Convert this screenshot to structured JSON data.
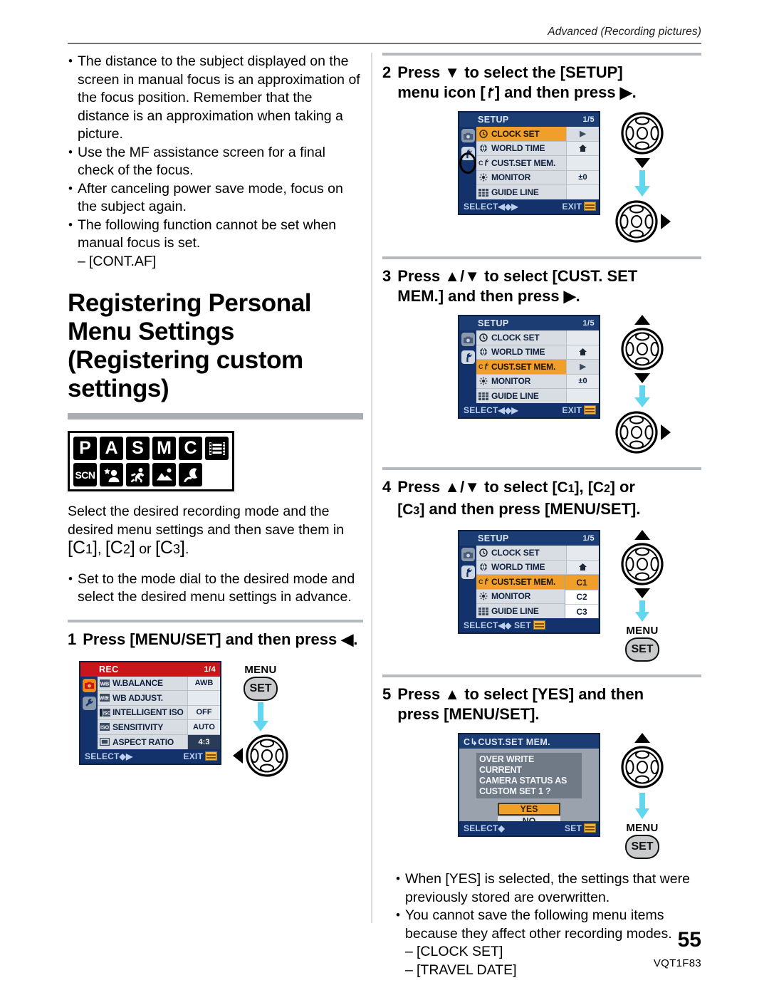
{
  "header": {
    "running_head": "Advanced (Recording pictures)"
  },
  "footer": {
    "page_number": "55",
    "doc_code": "VQT1F83"
  },
  "colors": {
    "accent_orange": "#f0a02a",
    "lcd_blue": "#13326b",
    "rec_red": "#c8161c",
    "arrow_cyan": "#63d6ef",
    "rule_gray": "#a9acb1"
  },
  "left_column": {
    "notes": [
      "The distance to the subject displayed on the screen in manual focus is an approximation of the focus position. Remember that the distance is an approximation when taking a picture.",
      "Use the MF assistance screen for a final check of the focus.",
      "After canceling power save mode, focus on the subject again.",
      "The following function cannot be set when manual focus is set."
    ],
    "note_sub_item": "[CONT.AF]",
    "section_title": "Registering Personal Menu Settings (Registering custom settings)",
    "mode_icons_row1": [
      "P",
      "A",
      "S",
      "M",
      "C",
      "movie-icon"
    ],
    "mode_icons_row2": [
      "SCN",
      "portrait-icon",
      "sports-icon",
      "scenery-icon",
      "night-portrait-icon"
    ],
    "intro_part1": "Select the desired recording mode and the desired menu settings and then save them in ",
    "intro_c1": "[C1]",
    "intro_sep1": ", ",
    "intro_c2": "[C2]",
    "intro_sep2": " or ",
    "intro_c3": "[C3]",
    "intro_end": ".",
    "intro_bullet": "Set to the mode dial to the desired mode and select the desired menu settings in advance.",
    "step1": {
      "number": "1",
      "text": "Press [MENU/SET] and then press ◀."
    },
    "step1_figure": {
      "screen": {
        "title": "REC",
        "page_indicator": "1/4",
        "rows": [
          {
            "icon": "wb-icon",
            "label": "W.BALANCE",
            "value": "AWB"
          },
          {
            "icon": "wb-adjust-icon",
            "label": "WB ADJUST.",
            "value": ""
          },
          {
            "icon": "intelligent-iso-icon",
            "label": "INTELLIGENT ISO",
            "value": "OFF"
          },
          {
            "icon": "sensitivity-icon",
            "label": "SENSITIVITY",
            "value": "AUTO"
          },
          {
            "icon": "aspect-ratio-icon",
            "label": "ASPECT RATIO",
            "value": "4:3"
          }
        ],
        "footer_select": "SELECT",
        "footer_exit": "EXIT"
      },
      "controls": {
        "menu_label": "MENU",
        "set_label": "SET",
        "direction": "left"
      }
    }
  },
  "right_column": {
    "step2": {
      "number": "2",
      "text_a": "Press ▼ to select the [SETUP]",
      "text_b": "menu icon [",
      "text_c": "] and then press ▶.",
      "icon": "wrench-icon"
    },
    "step2_figure": {
      "screen": {
        "title": "SETUP",
        "page_indicator": "1/5",
        "rows": [
          {
            "icon": "clock-icon",
            "label": "CLOCK SET",
            "value": "",
            "highlighted": true,
            "arrow": true
          },
          {
            "icon": "globe-icon",
            "label": "WORLD TIME",
            "value": "home-icon"
          },
          {
            "icon": "custom-set-icon",
            "label": "CUST.SET MEM.",
            "value": ""
          },
          {
            "icon": "monitor-icon",
            "label": "MONITOR",
            "value": "±0"
          },
          {
            "icon": "guideline-icon",
            "label": "GUIDE LINE",
            "value": ""
          }
        ],
        "footer_select": "SELECT",
        "footer_exit": "EXIT",
        "tab_highlight": "wrench-tab"
      },
      "controls": {
        "first_dir": "down",
        "second_dir": "right"
      }
    },
    "step3": {
      "number": "3",
      "text_a": "Press ▲/▼ to select [CUST. SET",
      "text_b": "MEM.] and then press ▶."
    },
    "step3_figure": {
      "screen": {
        "title": "SETUP",
        "page_indicator": "1/5",
        "rows": [
          {
            "icon": "clock-icon",
            "label": "CLOCK SET",
            "value": ""
          },
          {
            "icon": "globe-icon",
            "label": "WORLD TIME",
            "value": "home-icon"
          },
          {
            "icon": "custom-set-icon",
            "label": "CUST.SET MEM.",
            "value": "",
            "highlighted": true,
            "arrow": true
          },
          {
            "icon": "monitor-icon",
            "label": "MONITOR",
            "value": "±0"
          },
          {
            "icon": "guideline-icon",
            "label": "GUIDE LINE",
            "value": ""
          }
        ],
        "footer_select": "SELECT",
        "footer_exit": "EXIT"
      },
      "controls": {
        "first_dir": "up-down",
        "second_dir": "right"
      }
    },
    "step4": {
      "number": "4",
      "text_a": "Press ▲/▼ to select ",
      "c1": "[C1]",
      "sep1": ", ",
      "c2": "[C2]",
      "text_b": " or",
      "c3": "[C3]",
      "text_c": " and then press [MENU/SET]."
    },
    "step4_figure": {
      "screen": {
        "title": "SETUP",
        "page_indicator": "1/5",
        "rows": [
          {
            "icon": "clock-icon",
            "label": "CLOCK SET",
            "value": ""
          },
          {
            "icon": "globe-icon",
            "label": "WORLD TIME",
            "value": "home-icon"
          },
          {
            "icon": "custom-set-icon",
            "label": "CUST.SET MEM.",
            "value": "C1",
            "highlighted": true
          },
          {
            "icon": "monitor-icon",
            "label": "MONITOR",
            "value": ""
          },
          {
            "icon": "guideline-icon",
            "label": "GUIDE LINE",
            "value": ""
          }
        ],
        "submenu": [
          "C1",
          "C2",
          "C3"
        ],
        "submenu_selected": "C1",
        "footer_select": "SELECT",
        "footer_set": "SET"
      },
      "controls": {
        "menu_label": "MENU",
        "set_label": "SET"
      }
    },
    "step5": {
      "number": "5",
      "text_a": "Press ▲ to select [YES] and then",
      "text_b": "press [MENU/SET]."
    },
    "step5_figure": {
      "screen": {
        "title": "CUST.SET MEM.",
        "message_lines": [
          "OVER WRITE CURRENT",
          "CAMERA STATUS AS",
          "CUSTOM SET 1 ?"
        ],
        "yes_label": "YES",
        "no_label": "NO",
        "footer_select": "SELECT",
        "footer_set": "SET"
      },
      "controls": {
        "menu_label": "MENU",
        "set_label": "SET"
      }
    },
    "final_notes": [
      "When [YES] is selected, the settings that were previously stored are overwritten.",
      "You cannot save the following menu items because they affect other recording modes."
    ],
    "final_sub_items": [
      "[CLOCK SET]",
      "[TRAVEL DATE]"
    ]
  }
}
